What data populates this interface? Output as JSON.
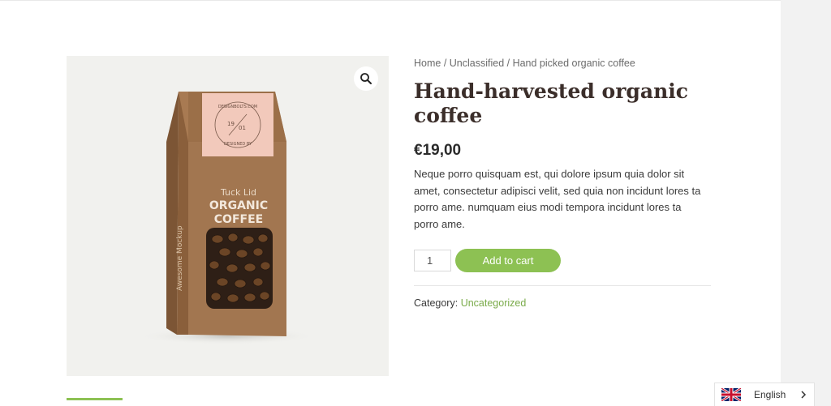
{
  "breadcrumb": {
    "home": "Home",
    "sep1": " / ",
    "category": "Unclassified",
    "sep2": " / ",
    "current": "Hand picked organic coffee"
  },
  "product": {
    "title": "Hand-harvested organic coffee",
    "price": "€19,00",
    "description": "Neque porro quisquam est, qui dolore ipsum quia dolor sit amet, consectetur adipisci velit, sed quia non incidunt lores ta porro ame. numquam eius modi tempora incidunt lores ta porro ame.",
    "quantity": "1",
    "add_to_cart": "Add to cart",
    "category_label": "Category:",
    "category_value": "Uncategorized"
  },
  "package": {
    "label_line1": "Tuck Lid",
    "label_line2": "ORGANIC",
    "label_line3": "COFFEE",
    "side_text": "Awesome Mockup",
    "seal_top": "DESIGNBOLTS.COM",
    "seal_bottom": "DESIGNED BY",
    "seal_left": "19",
    "seal_right": "01"
  },
  "icons": {
    "zoom": "magnifier-icon",
    "flag": "uk-flag-icon",
    "chevron": "chevron-right-icon"
  },
  "language": {
    "current": "English"
  },
  "colors": {
    "accent": "#8dc153",
    "link": "#7aab4a",
    "title": "#3b2e2a",
    "image_bg": "#f1f1ee"
  }
}
